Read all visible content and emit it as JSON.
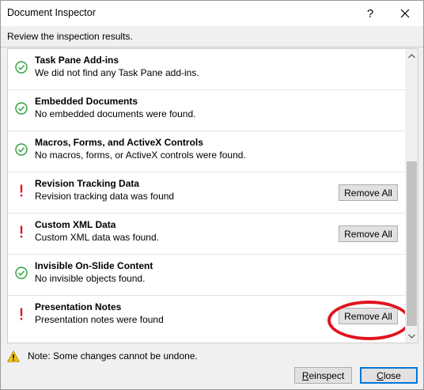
{
  "window": {
    "title": "Document Inspector",
    "help_glyph": "?",
    "subtitle": "Review the inspection results."
  },
  "items": [
    {
      "title": "Task Pane Add-ins",
      "description": "We did not find any Task Pane add-ins.",
      "status": "ok",
      "action": ""
    },
    {
      "title": "Embedded Documents",
      "description": "No embedded documents were found.",
      "status": "ok",
      "action": ""
    },
    {
      "title": "Macros, Forms, and ActiveX Controls",
      "description": "No macros, forms, or ActiveX controls were found.",
      "status": "ok",
      "action": ""
    },
    {
      "title": "Revision Tracking Data",
      "description": "Revision tracking data was found",
      "status": "warning",
      "action": "Remove All"
    },
    {
      "title": "Custom XML Data",
      "description": "Custom XML data was found.",
      "status": "warning",
      "action": "Remove All"
    },
    {
      "title": "Invisible On-Slide Content",
      "description": "No invisible objects found.",
      "status": "ok",
      "action": ""
    },
    {
      "title": "Presentation Notes",
      "description": "Presentation notes were found",
      "status": "warning",
      "action": "Remove All"
    }
  ],
  "footer": {
    "note": "Note: Some changes cannot be undone.",
    "reinspect_first": "R",
    "reinspect_rest": "einspect",
    "close_first": "C",
    "close_rest": "lose"
  },
  "colors": {
    "ok_green": "#2e9e3a",
    "warning_red": "#e0141e",
    "annotation_red": "#e0141e",
    "warning_yellow": "#f5c211"
  }
}
